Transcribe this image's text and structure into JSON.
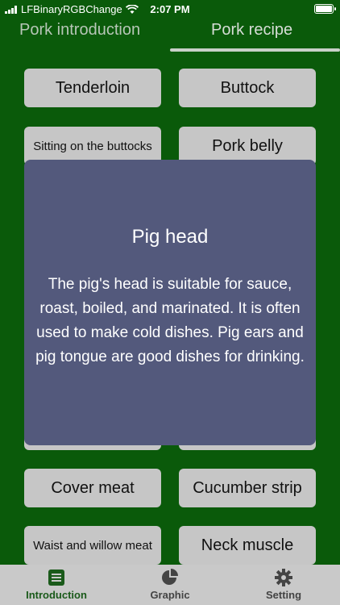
{
  "status_bar": {
    "carrier": "LFBinaryRGBChange",
    "time": "2:07 PM"
  },
  "top_tabs": [
    {
      "label": "Pork introduction"
    },
    {
      "label": "Pork recipe"
    }
  ],
  "cuts": [
    {
      "label": "Tenderloin"
    },
    {
      "label": "Buttock"
    },
    {
      "label": "Sitting on the buttocks"
    },
    {
      "label": "Pork belly"
    },
    {
      "label": "Cover meat"
    },
    {
      "label": "Cucumber strip"
    },
    {
      "label": "Waist and willow meat"
    },
    {
      "label": "Neck muscle"
    }
  ],
  "dialog": {
    "title": "Pig head",
    "body": "The pig's head is suitable for sauce, roast, boiled, and marinated. It is often used to make cold dishes. Pig ears and pig tongue are good dishes for drinking."
  },
  "tabbar": [
    {
      "label": "Introduction",
      "icon": "list-icon"
    },
    {
      "label": "Graphic",
      "icon": "pie-chart-icon"
    },
    {
      "label": "Setting",
      "icon": "gear-icon"
    }
  ],
  "colors": {
    "background": "#0a5a0a",
    "dialog": "#53597c",
    "button": "#c6c6c6",
    "tabbar": "#c9c9c9",
    "active_tab": "#1a5a1a"
  }
}
